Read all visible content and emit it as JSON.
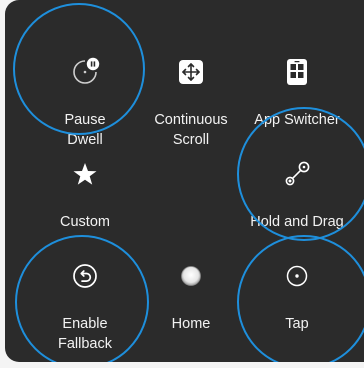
{
  "menu": {
    "items": [
      {
        "id": "pause-dwell",
        "label": "Pause\nDwell",
        "icon": "pause-dwell-icon"
      },
      {
        "id": "continuous-scroll",
        "label": "Continuous\nScroll",
        "icon": "scroll-arrows-icon"
      },
      {
        "id": "app-switcher",
        "label": "App Switcher",
        "icon": "app-switcher-icon"
      },
      {
        "id": "custom",
        "label": "Custom",
        "icon": "star-icon"
      },
      {
        "id": "hold-and-drag",
        "label": "Hold and Drag",
        "icon": "drag-icon"
      },
      {
        "id": "enable-fallback",
        "label": "Enable\nFallback",
        "icon": "undo-circle-icon"
      },
      {
        "id": "home",
        "label": "Home",
        "icon": "home-button-icon"
      },
      {
        "id": "tap",
        "label": "Tap",
        "icon": "tap-icon"
      }
    ]
  },
  "colors": {
    "panel": "#2b2b2b",
    "highlight_ring": "#1e8fdc",
    "text": "#ffffff"
  }
}
